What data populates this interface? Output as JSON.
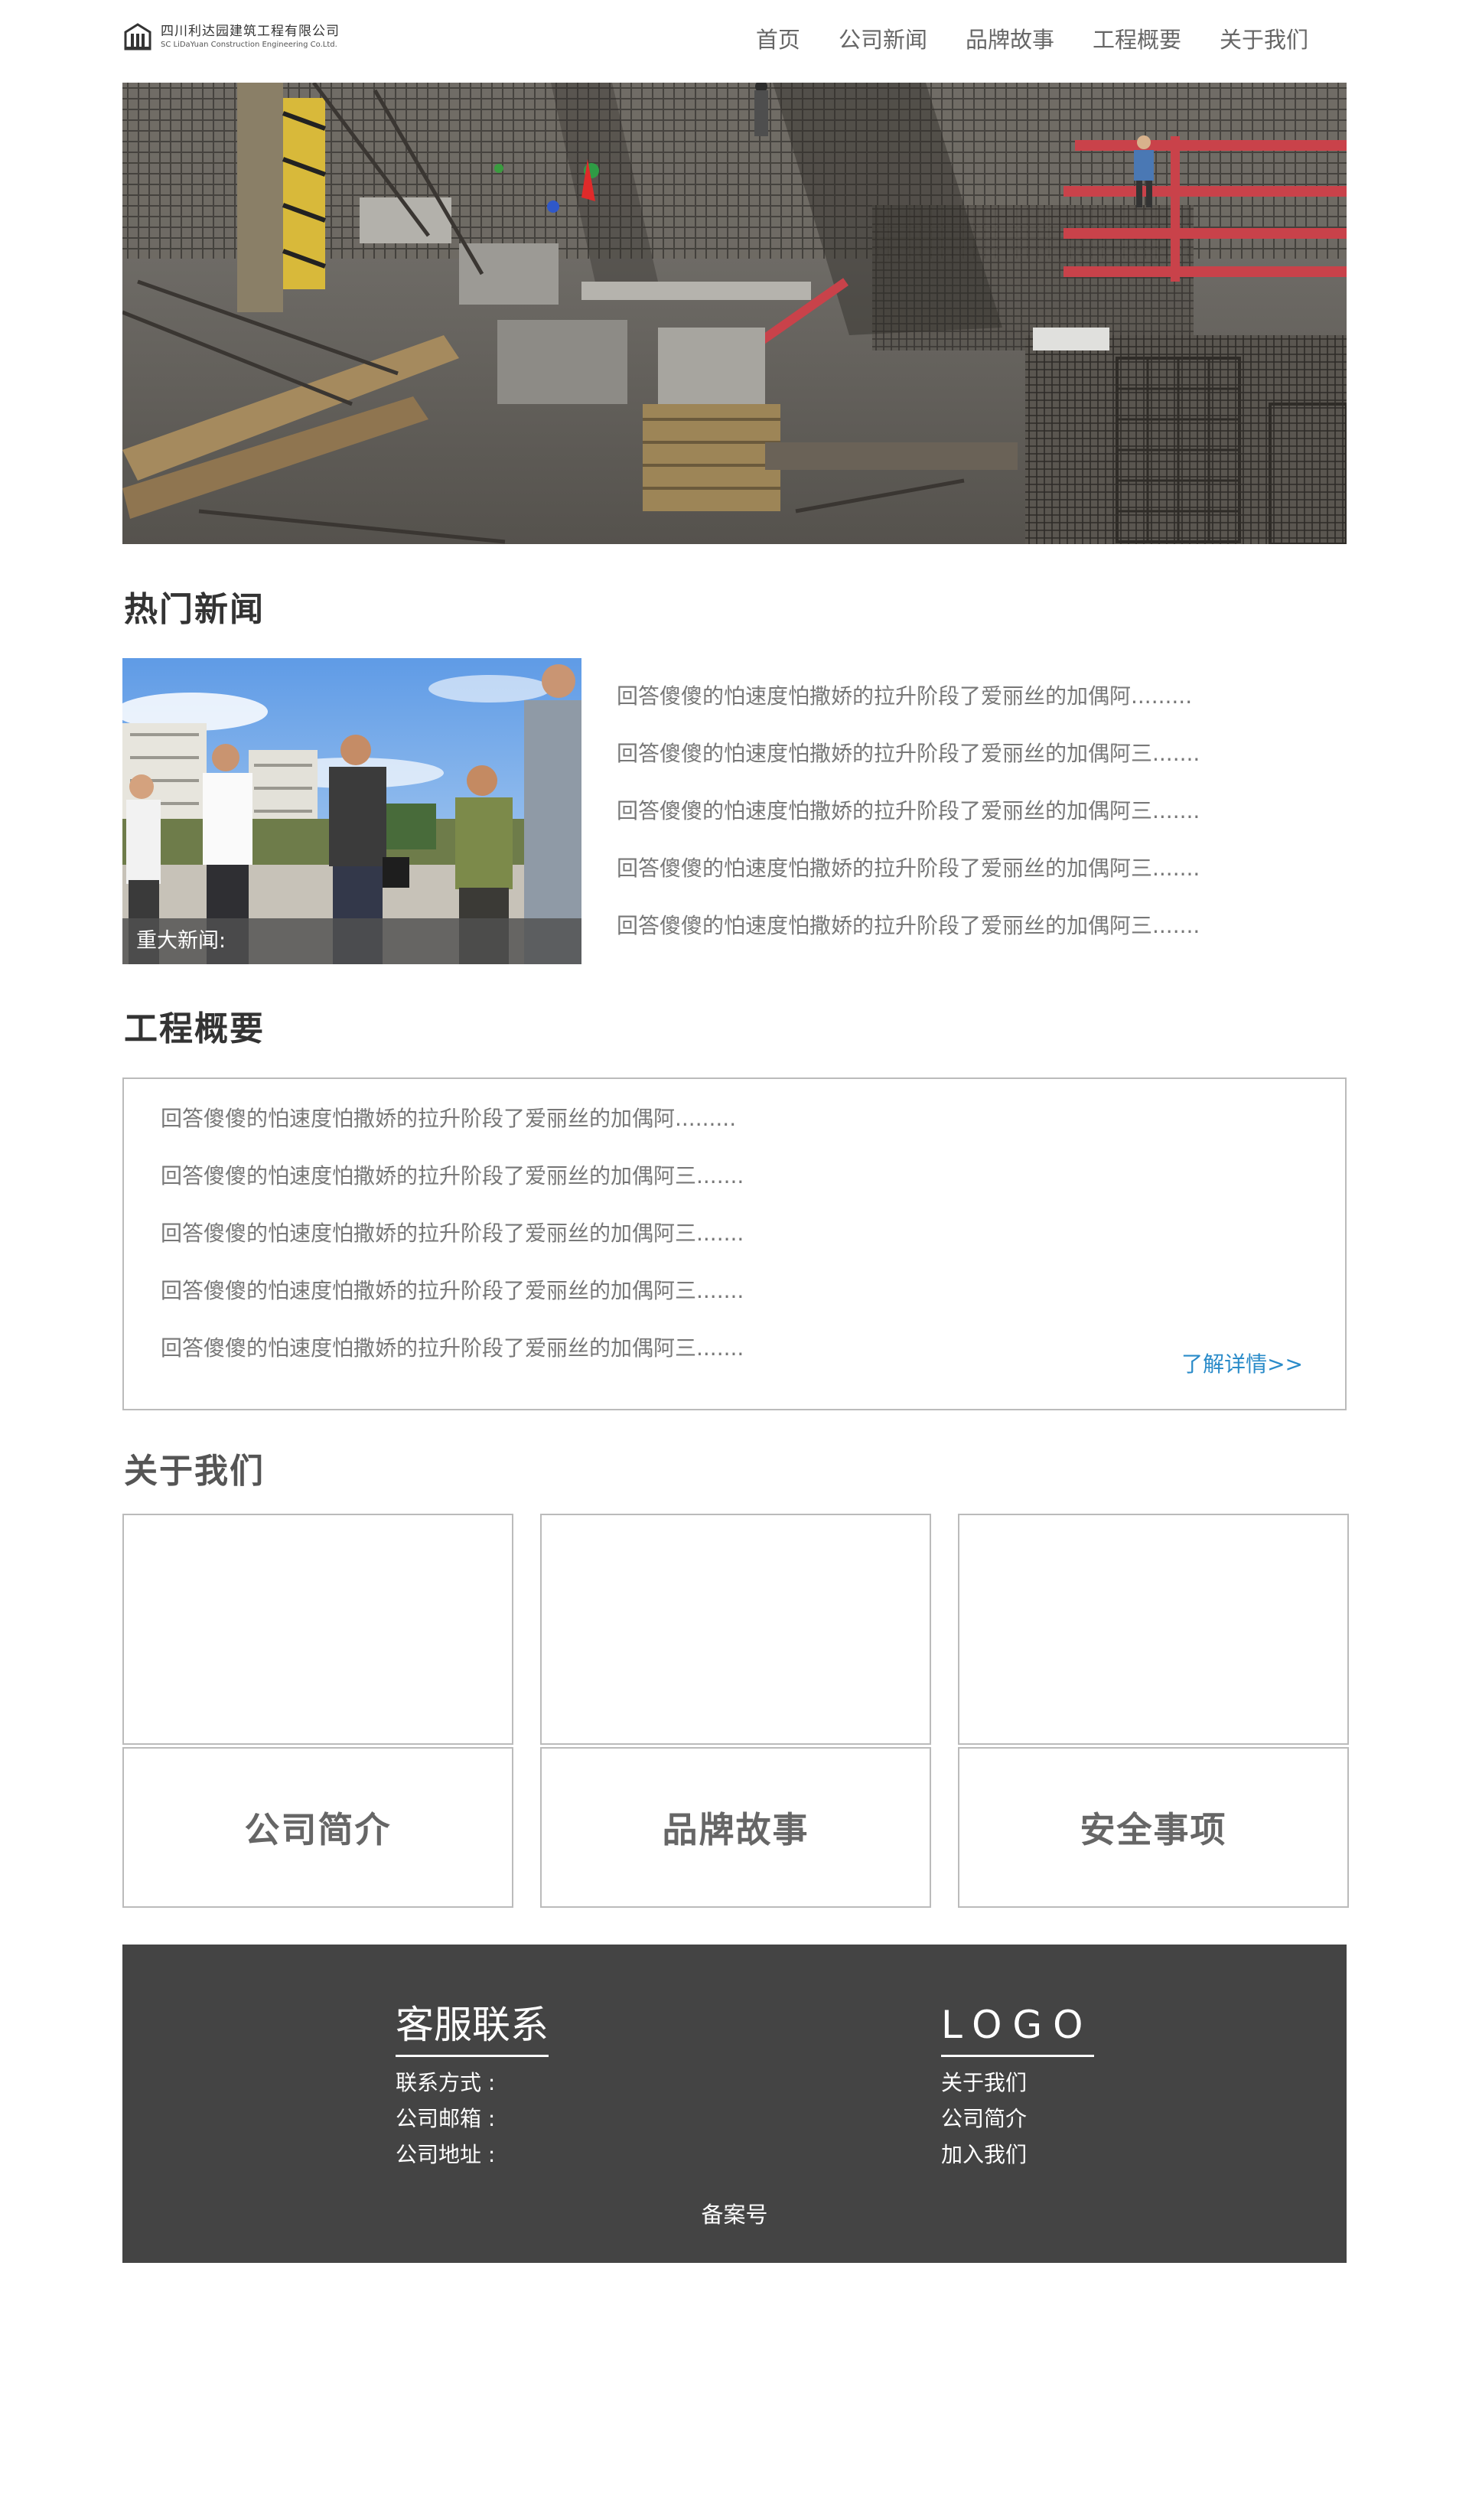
{
  "header": {
    "logo_cn": "四川利达园建筑工程有限公司",
    "logo_en": "SC LiDaYuan Construction Engineering Co.Ltd.",
    "nav": [
      "首页",
      "公司新闻",
      "品牌故事",
      "工程概要",
      "关于我们"
    ]
  },
  "hot_news": {
    "title": "热门新闻",
    "caption": "重大新闻:",
    "items": [
      "回答傻傻的怕速度怕撒娇的拉升阶段了爱丽丝的加偶阿.........",
      "回答傻傻的怕速度怕撒娇的拉升阶段了爱丽丝的加偶阿三.......",
      "回答傻傻的怕速度怕撒娇的拉升阶段了爱丽丝的加偶阿三.......",
      "回答傻傻的怕速度怕撒娇的拉升阶段了爱丽丝的加偶阿三.......",
      "回答傻傻的怕速度怕撒娇的拉升阶段了爱丽丝的加偶阿三......."
    ]
  },
  "overview": {
    "title": "工程概要",
    "items": [
      "回答傻傻的怕速度怕撒娇的拉升阶段了爱丽丝的加偶阿.........",
      "回答傻傻的怕速度怕撒娇的拉升阶段了爱丽丝的加偶阿三.......",
      "回答傻傻的怕速度怕撒娇的拉升阶段了爱丽丝的加偶阿三.......",
      "回答傻傻的怕速度怕撒娇的拉升阶段了爱丽丝的加偶阿三.......",
      "回答傻傻的怕速度怕撒娇的拉升阶段了爱丽丝的加偶阿三......."
    ],
    "more": "了解详情>>"
  },
  "about": {
    "title": "关于我们",
    "cards": [
      "公司简介",
      "品牌故事",
      "安全事项"
    ]
  },
  "footer": {
    "contact_title": "客服联系",
    "contact_lines": [
      "联系方式 :",
      "公司邮箱 :",
      "公司地址 :"
    ],
    "logo_title": "LOGO",
    "links": [
      "关于我们",
      "公司简介",
      "加入我们"
    ],
    "record": "备案号"
  },
  "colors": {
    "link_blue": "#2a8bc9",
    "footer_bg": "#444444",
    "border": "#bbbbbb"
  }
}
